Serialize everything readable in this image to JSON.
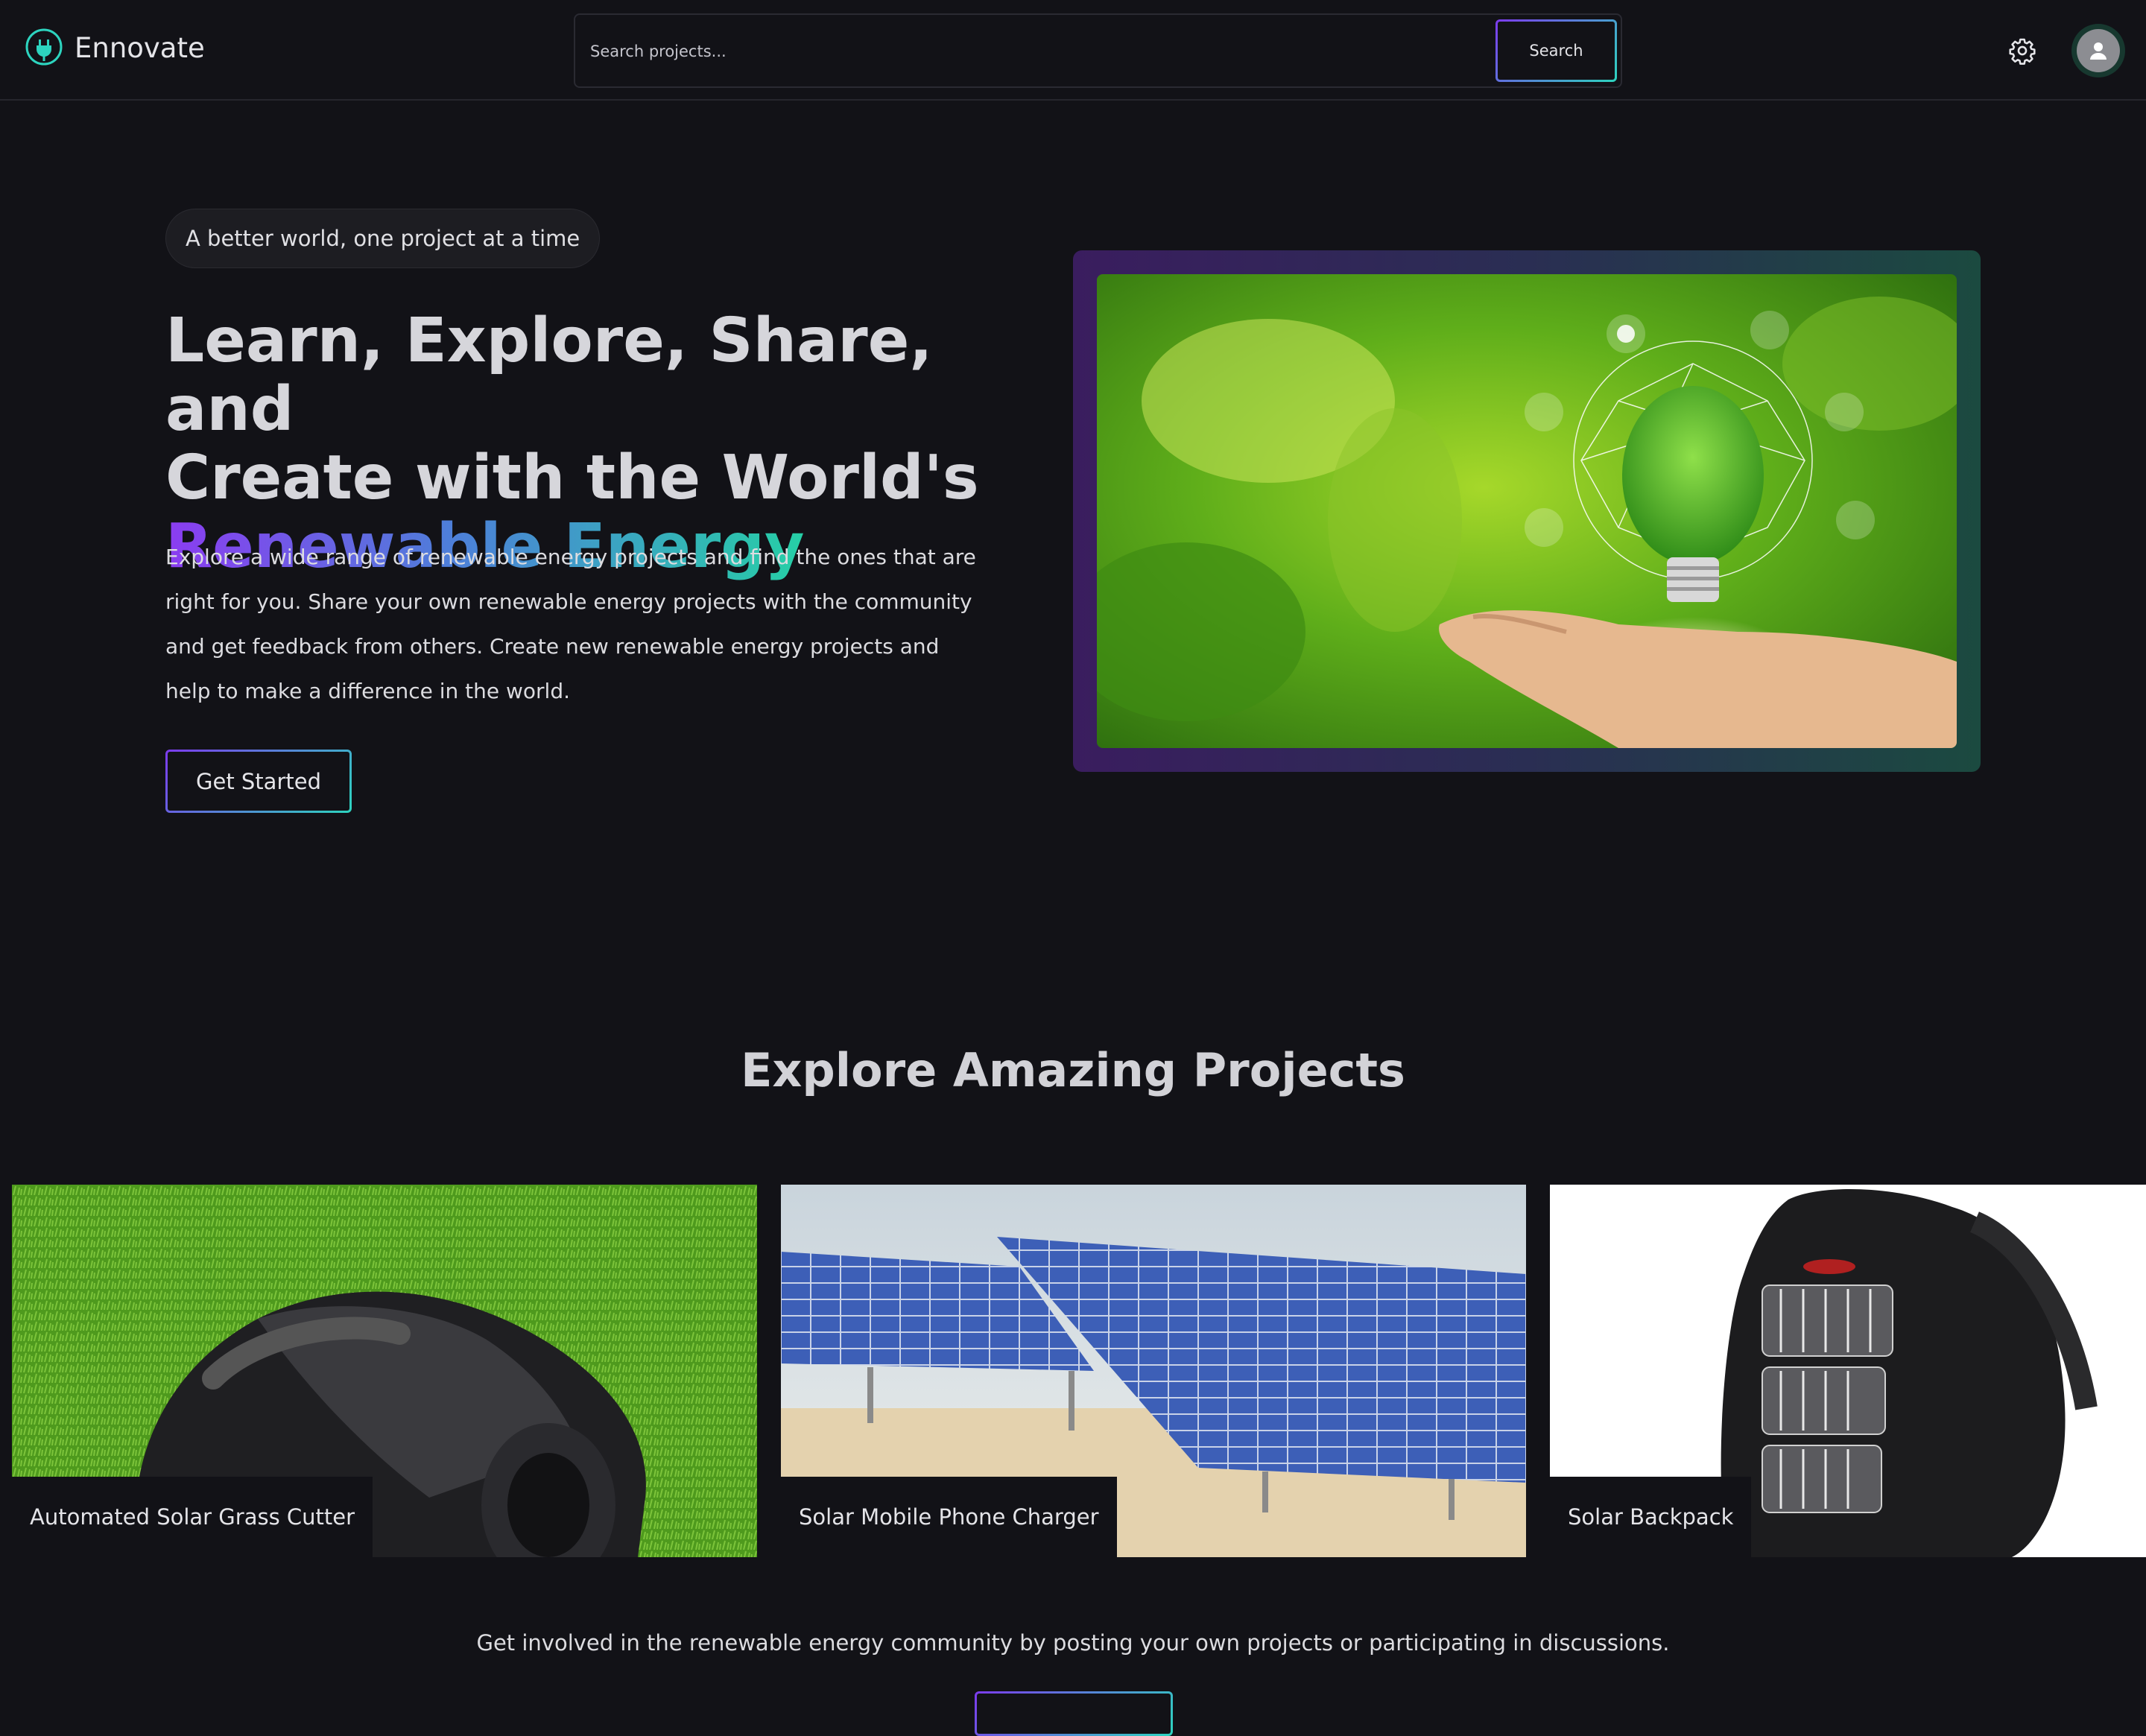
{
  "header": {
    "brand": "Ennovate",
    "logo_icon": "plug-icon",
    "search": {
      "placeholder": "Search projects...",
      "value": "",
      "button_label": "Search"
    },
    "settings_icon": "gear-icon",
    "avatar_icon": "user-icon"
  },
  "hero": {
    "tagline": "A better world, one project at a time",
    "headline_line1": "Learn, Explore, Share, and",
    "headline_line2": "Create with the World's",
    "headline_highlight": "Renewable Energy",
    "description": "Explore a wide range of renewable energy projects and find the ones that are right for you. Share your own renewable energy projects with the community and get feedback from others. Create new renewable energy projects and help to make a difference in the world.",
    "cta_label": "Get Started"
  },
  "projects": {
    "title": "Explore Amazing Projects",
    "items": [
      {
        "label": "Automated Solar Grass Cutter"
      },
      {
        "label": "Solar Mobile Phone Charger"
      },
      {
        "label": "Solar Backpack"
      }
    ],
    "cta_text": "Get involved in the renewable energy community by posting your own projects or participating in discussions."
  },
  "colors": {
    "background": "#121217",
    "accent_purple": "#7c3aed",
    "accent_teal": "#2dd4bf"
  }
}
